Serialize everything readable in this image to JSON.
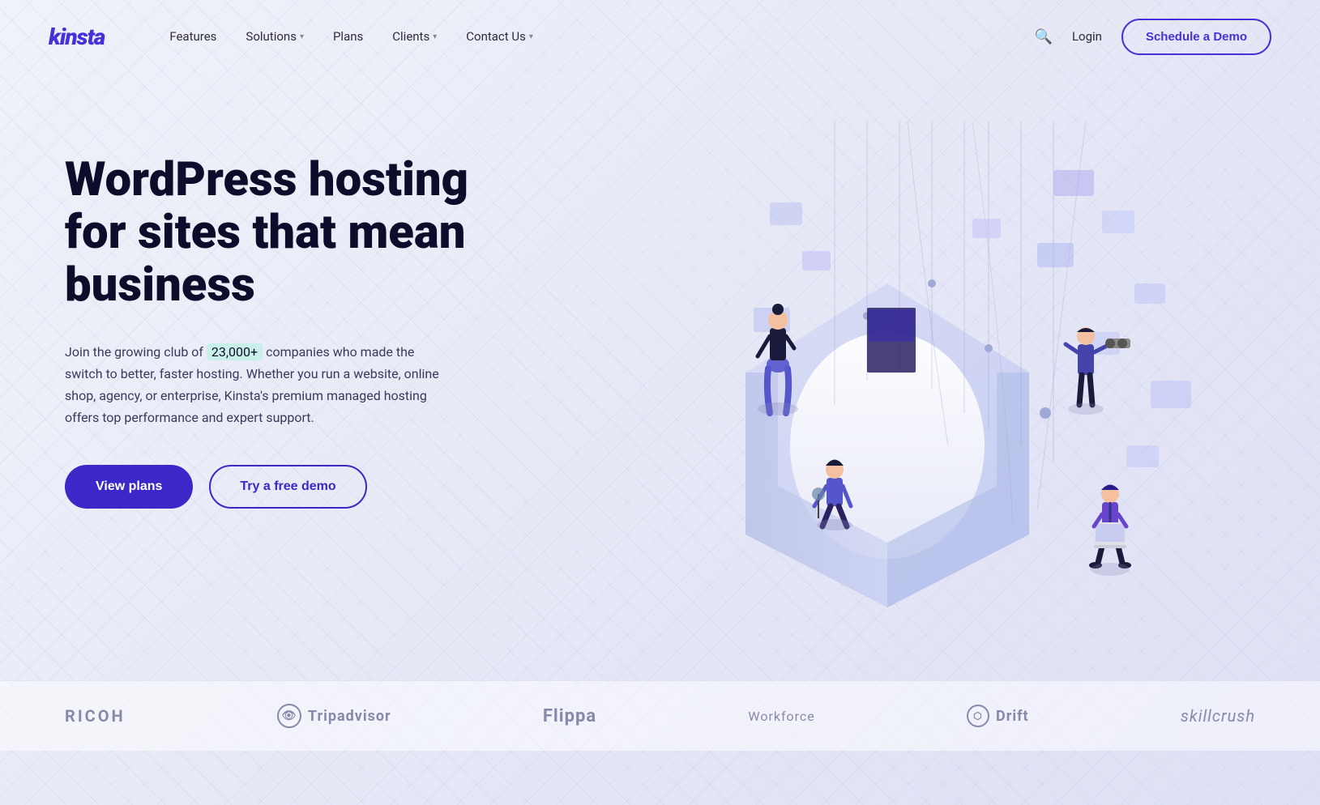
{
  "brand": {
    "logo": "kinsta",
    "logo_color": "#4730d8"
  },
  "nav": {
    "links": [
      {
        "label": "Features",
        "has_dropdown": false
      },
      {
        "label": "Solutions",
        "has_dropdown": true
      },
      {
        "label": "Plans",
        "has_dropdown": false
      },
      {
        "label": "Clients",
        "has_dropdown": true
      },
      {
        "label": "Contact Us",
        "has_dropdown": true
      }
    ],
    "login_label": "Login",
    "cta_label": "Schedule a Demo"
  },
  "hero": {
    "title": "WordPress hosting for sites that mean business",
    "description_prefix": "Join the growing club of",
    "highlight": "23,000+",
    "description_suffix": " companies who made the switch to better, faster hosting. Whether you run a website, online shop, agency, or enterprise, Kinsta's premium managed hosting offers top performance and expert support.",
    "btn_primary": "View plans",
    "btn_secondary": "Try a free demo"
  },
  "clients": [
    {
      "name": "RICOH",
      "style": "ricoh"
    },
    {
      "name": "Tripadvisor",
      "style": "tripadvisor",
      "has_icon": true
    },
    {
      "name": "Flippa",
      "style": "flippa"
    },
    {
      "name": "Workforce",
      "style": "workforce"
    },
    {
      "name": "Drift",
      "style": "drift",
      "has_icon": true
    },
    {
      "name": "skillcrush",
      "style": "skillcrush"
    }
  ]
}
